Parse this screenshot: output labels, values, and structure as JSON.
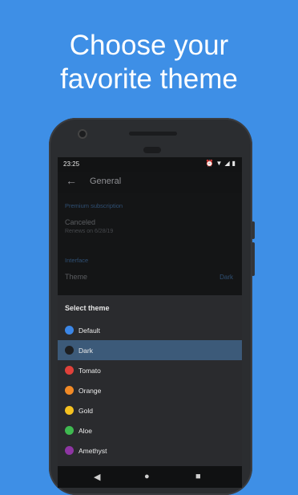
{
  "headline": {
    "line1": "Choose your",
    "line2": "favorite theme"
  },
  "status_bar": {
    "time": "23:25"
  },
  "app_bar": {
    "title": "General"
  },
  "settings": {
    "premium_header": "Premium subscription",
    "subscription_status": "Canceled",
    "renewal": "Renews on 6/28/19",
    "interface_header": "Interface",
    "theme_label": "Theme",
    "theme_value": "Dark"
  },
  "theme_sheet": {
    "title": "Select theme",
    "options": [
      {
        "label": "Default",
        "color": "#3b86e6"
      },
      {
        "label": "Dark",
        "color": "#1d1f22"
      },
      {
        "label": "Tomato",
        "color": "#e0413a"
      },
      {
        "label": "Orange",
        "color": "#f18a26"
      },
      {
        "label": "Gold",
        "color": "#f5c120"
      },
      {
        "label": "Aloe",
        "color": "#3fb950"
      },
      {
        "label": "Amethyst",
        "color": "#8e35a3"
      }
    ],
    "selected": "Dark"
  },
  "colors": {
    "background": "#3e8fe6",
    "accent": "#3c5a79"
  }
}
